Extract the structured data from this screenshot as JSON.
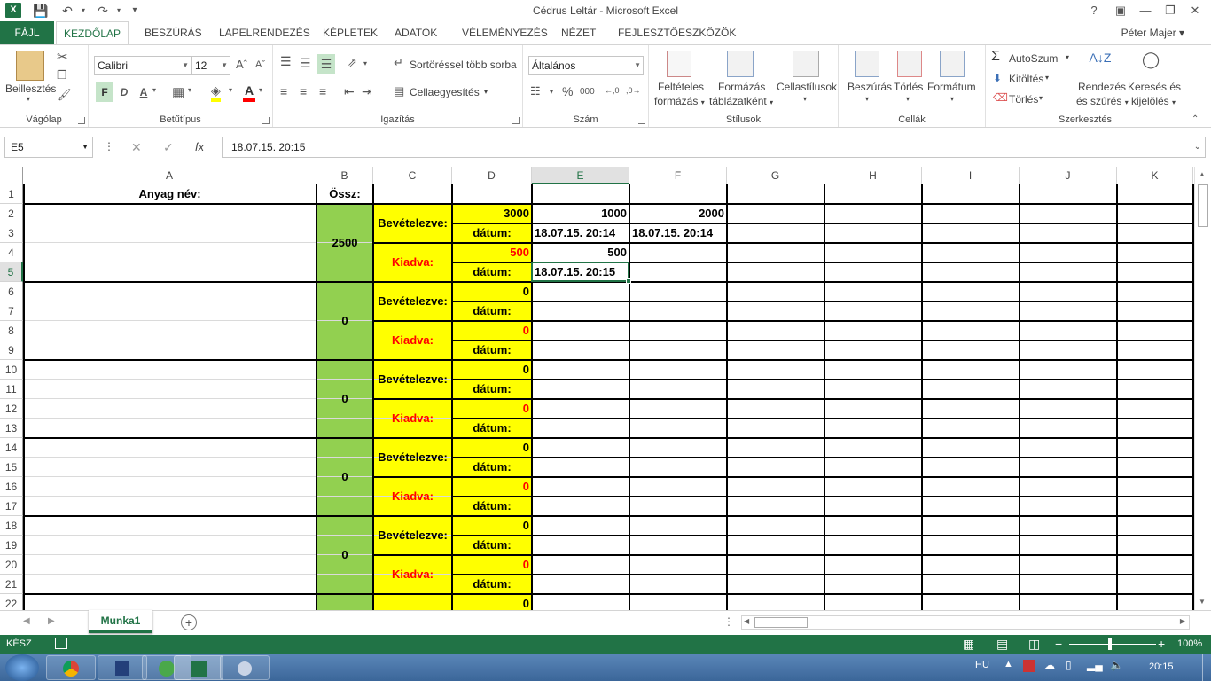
{
  "window": {
    "title": "Cédrus Leltár - Microsoft Excel",
    "help": "?",
    "user": "Péter Majer"
  },
  "tabs": [
    "FÁJL",
    "KEZDŐLAP",
    "BESZÚRÁS",
    "LAPELRENDEZÉS",
    "KÉPLETEK",
    "ADATOK",
    "VÉLEMÉNYEZÉS",
    "NÉZET",
    "FEJLESZTŐESZKÖZÖK"
  ],
  "ribbon": {
    "clipboard": {
      "paste": "Beillesztés",
      "label": "Vágólap"
    },
    "font": {
      "name": "Calibri",
      "size": "12",
      "bold": "F",
      "italic": "D",
      "underline": "A",
      "color_letter": "A",
      "label": "Betűtípus"
    },
    "alignment": {
      "wrap": "Sortöréssel több sorba",
      "merge": "Cellaegyesítés",
      "label": "Igazítás"
    },
    "number": {
      "format": "Általános",
      "percent": "%",
      "thousands": "000",
      "label": "Szám"
    },
    "styles": {
      "cond": [
        "Feltételes",
        "formázás"
      ],
      "table": [
        "Formázás",
        "táblázatként"
      ],
      "cellstyles": "Cellastílusok",
      "label": "Stílusok"
    },
    "cells": {
      "insert": "Beszúrás",
      "delete": "Törlés",
      "format": "Formátum",
      "label": "Cellák"
    },
    "editing": {
      "autosum": "AutoSzum",
      "fill": "Kitöltés",
      "clear": "Törlés",
      "sort": [
        "Rendezés",
        "és szűrés"
      ],
      "find": [
        "Keresés és",
        "kijelölés"
      ],
      "label": "Szerkesztés"
    }
  },
  "formula_bar": {
    "name_box": "E5",
    "fx": "fx",
    "value": "18.07.15. 20:15"
  },
  "columns": [
    "A",
    "B",
    "C",
    "D",
    "E",
    "F",
    "G",
    "H",
    "I",
    "J",
    "K"
  ],
  "rows": [
    "1",
    "2",
    "3",
    "4",
    "5",
    "6",
    "7",
    "8",
    "9",
    "10",
    "11",
    "12",
    "13",
    "14",
    "15",
    "16",
    "17",
    "18",
    "19",
    "20",
    "21",
    "22"
  ],
  "sheet": {
    "a1": "Anyag név:",
    "b1": "Össz:",
    "blocks": [
      {
        "total": "2500",
        "in_label": "Bevételezve:",
        "in_qty": "3000",
        "date_label": "dátum:",
        "out_label": "Kiadva:",
        "out_qty": "500",
        "date_label2": "dátum:",
        "e_in": "1000",
        "e_in_date": "18.07.15. 20:14",
        "f_in": "2000",
        "f_in_date": "18.07.15. 20:14",
        "e_out": "500",
        "e_out_date": "18.07.15. 20:15"
      },
      {
        "total": "0",
        "in_label": "Bevételezve:",
        "in_qty": "0",
        "date_label": "dátum:",
        "out_label": "Kiadva:",
        "out_qty": "0",
        "date_label2": "dátum:"
      },
      {
        "total": "0",
        "in_label": "Bevételezve:",
        "in_qty": "0",
        "date_label": "dátum:",
        "out_label": "Kiadva:",
        "out_qty": "0",
        "date_label2": "dátum:"
      },
      {
        "total": "0",
        "in_label": "Bevételezve:",
        "in_qty": "0",
        "date_label": "dátum:",
        "out_label": "Kiadva:",
        "out_qty": "0",
        "date_label2": "dátum:"
      },
      {
        "total": "0",
        "in_label": "Bevételezve:",
        "in_qty": "0",
        "date_label": "dátum:",
        "out_label": "Kiadva:",
        "out_qty": "0",
        "date_label2": "dátum:"
      }
    ],
    "row22_qty": "0"
  },
  "sheet_tabs": [
    "Munka1"
  ],
  "status": {
    "ready": "KÉSZ",
    "zoom": "100%"
  },
  "taskbar": {
    "lang": "HU",
    "time": "20:15"
  },
  "colors": {
    "excel_green": "#217346",
    "yellow": "#ffff00",
    "green_cell": "#92d050",
    "red_text": "#ff0000"
  }
}
